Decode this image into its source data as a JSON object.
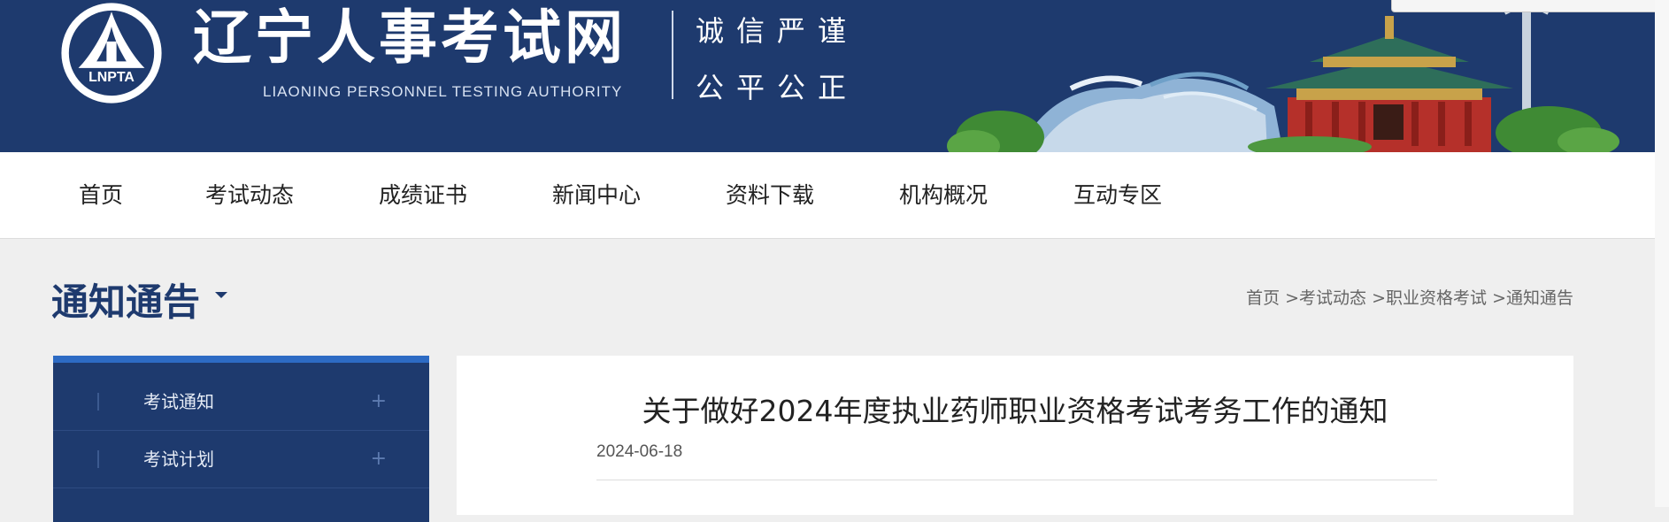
{
  "header": {
    "logo_text": "LNPTA",
    "site_title": "辽宁人事考试网",
    "site_subtitle": "LIAONING PERSONNEL TESTING AUTHORITY",
    "slogan_line1": "诚信严谨",
    "slogan_line2": "公平公正",
    "bg_color": "#1e3a6e"
  },
  "nav": {
    "items": [
      {
        "label": "首页"
      },
      {
        "label": "考试动态"
      },
      {
        "label": "成绩证书"
      },
      {
        "label": "新闻中心"
      },
      {
        "label": "资料下载"
      },
      {
        "label": "机构概况"
      },
      {
        "label": "互动专区"
      }
    ]
  },
  "section": {
    "title": "通知通告",
    "breadcrumb": [
      "首页",
      ">考试动态",
      ">职业资格考试",
      ">通知通告"
    ]
  },
  "sidebar": {
    "items": [
      {
        "label": "考试通知",
        "toggle": "+"
      },
      {
        "label": "考试计划",
        "toggle": "+"
      }
    ],
    "accent_color": "#2d6bc4"
  },
  "article": {
    "title": "关于做好2024年度执业药师职业资格考试考务工作的通知",
    "date": "2024-06-18"
  }
}
